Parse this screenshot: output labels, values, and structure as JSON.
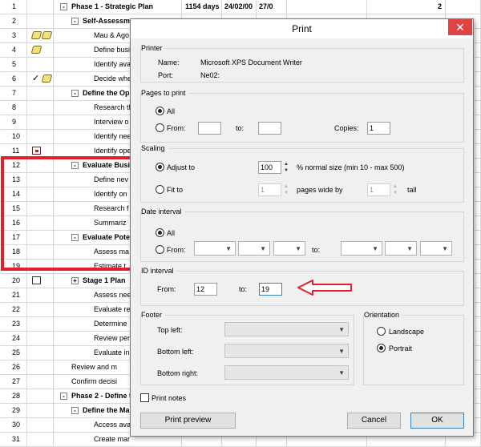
{
  "grid": {
    "rows": [
      {
        "id": "1",
        "indicators": [],
        "toggle": "-",
        "name": "Phase 1 - Strategic Plan",
        "bold": true,
        "indent": 0,
        "duration": "1154 days",
        "start": "24/02/00",
        "finish": "27/0",
        "x2": "2"
      },
      {
        "id": "2",
        "indicators": [],
        "toggle": "-",
        "name": "Self-Assessmen",
        "bold": true,
        "indent": 1
      },
      {
        "id": "3",
        "indicators": [
          "note-icon",
          "note-icon"
        ],
        "toggle": "",
        "name": "Mau & Ago",
        "bold": false,
        "indent": 2
      },
      {
        "id": "4",
        "indicators": [
          "note-icon"
        ],
        "toggle": "",
        "name": "Define busi",
        "bold": false,
        "indent": 2
      },
      {
        "id": "5",
        "indicators": [],
        "toggle": "",
        "name": "Identify ava",
        "bold": false,
        "indent": 2
      },
      {
        "id": "6",
        "indicators": [
          "check-icon",
          "note-icon"
        ],
        "toggle": "",
        "name": "Decide whe",
        "bold": false,
        "indent": 2
      },
      {
        "id": "7",
        "indicators": [],
        "toggle": "-",
        "name": "Define the Opp",
        "bold": true,
        "indent": 1
      },
      {
        "id": "8",
        "indicators": [],
        "toggle": "",
        "name": "Research th",
        "bold": false,
        "indent": 2
      },
      {
        "id": "9",
        "indicators": [],
        "toggle": "",
        "name": "Interview o",
        "bold": false,
        "indent": 2
      },
      {
        "id": "10",
        "indicators": [],
        "toggle": "",
        "name": "Identify nee",
        "bold": false,
        "indent": 2
      },
      {
        "id": "11",
        "indicators": [
          "calendar-icon"
        ],
        "toggle": "",
        "name": "Identify ope",
        "bold": false,
        "indent": 2
      },
      {
        "id": "12",
        "indicators": [],
        "toggle": "-",
        "name": "Evaluate Busin",
        "bold": true,
        "indent": 1
      },
      {
        "id": "13",
        "indicators": [],
        "toggle": "",
        "name": "Define nev",
        "bold": false,
        "indent": 2
      },
      {
        "id": "14",
        "indicators": [],
        "toggle": "",
        "name": "Identify on",
        "bold": false,
        "indent": 2
      },
      {
        "id": "15",
        "indicators": [],
        "toggle": "",
        "name": "Research f",
        "bold": false,
        "indent": 2
      },
      {
        "id": "16",
        "indicators": [],
        "toggle": "",
        "name": "Summariz",
        "bold": false,
        "indent": 2
      },
      {
        "id": "17",
        "indicators": [],
        "toggle": "-",
        "name": "Evaluate Poter",
        "bold": true,
        "indent": 1
      },
      {
        "id": "18",
        "indicators": [],
        "toggle": "",
        "name": "Assess ma",
        "bold": false,
        "indent": 2
      },
      {
        "id": "19",
        "indicators": [],
        "toggle": "",
        "name": "Estimate t",
        "bold": false,
        "indent": 2
      },
      {
        "id": "20",
        "indicators": [
          "document-icon"
        ],
        "toggle": "+",
        "name": "Stage 1 Plan",
        "bold": true,
        "indent": 1
      },
      {
        "id": "21",
        "indicators": [],
        "toggle": "",
        "name": "Assess nee",
        "bold": false,
        "indent": 2
      },
      {
        "id": "22",
        "indicators": [],
        "toggle": "",
        "name": "Evaluate re",
        "bold": false,
        "indent": 2
      },
      {
        "id": "23",
        "indicators": [],
        "toggle": "",
        "name": "Determine",
        "bold": false,
        "indent": 2
      },
      {
        "id": "24",
        "indicators": [],
        "toggle": "",
        "name": "Review per",
        "bold": false,
        "indent": 2
      },
      {
        "id": "25",
        "indicators": [],
        "toggle": "",
        "name": "Evaluate in",
        "bold": false,
        "indent": 2
      },
      {
        "id": "26",
        "indicators": [],
        "toggle": "",
        "name": "Review and m",
        "bold": false,
        "indent": 1
      },
      {
        "id": "27",
        "indicators": [],
        "toggle": "",
        "name": "Confirm decisi",
        "bold": false,
        "indent": 1
      },
      {
        "id": "28",
        "indicators": [],
        "toggle": "-",
        "name": "Phase 2 - Define th",
        "bold": true,
        "indent": 0
      },
      {
        "id": "29",
        "indicators": [],
        "toggle": "-",
        "name": "Define the Mar",
        "bold": true,
        "indent": 1
      },
      {
        "id": "30",
        "indicators": [],
        "toggle": "",
        "name": "Access ava",
        "bold": false,
        "indent": 2
      },
      {
        "id": "31",
        "indicators": [],
        "toggle": "",
        "name": "Create mar",
        "bold": false,
        "indent": 2
      }
    ]
  },
  "dialog": {
    "title": "Print",
    "close_glyph": "✕",
    "printer": {
      "group_label": "Printer",
      "name_label": "Name:",
      "name_value": "Microsoft XPS Document Writer",
      "port_label": "Port:",
      "port_value": "Ne02:"
    },
    "pages": {
      "group_label": "Pages to print",
      "all_label": "All",
      "from_label": "From:",
      "to_label": "to:",
      "copies_label": "Copies:",
      "copies_value": "1",
      "from_value": "",
      "to_value": ""
    },
    "scaling": {
      "group_label": "Scaling",
      "adjust_label": "Adjust to",
      "adjust_value": "100",
      "adjust_suffix": "% normal size (min 10 - max 500)",
      "fit_label": "Fit to",
      "fit_wide_value": "1",
      "fit_wide_suffix": "pages wide by",
      "fit_tall_value": "1",
      "fit_tall_suffix": "tall"
    },
    "date_interval": {
      "group_label": "Date interval",
      "all_label": "All",
      "from_label": "From:",
      "to_label": "to:"
    },
    "id_interval": {
      "group_label": "ID interval",
      "from_label": "From:",
      "from_value": "12",
      "to_label": "to:",
      "to_value": "19"
    },
    "footer": {
      "group_label": "Footer",
      "top_left_label": "Top left:",
      "bottom_left_label": "Bottom left:",
      "bottom_right_label": "Bottom right:"
    },
    "orientation": {
      "group_label": "Orientation",
      "landscape_label": "Landscape",
      "portrait_label": "Portrait",
      "selected": "Portrait"
    },
    "print_notes_label": "Print notes",
    "print_preview_label": "Print preview",
    "cancel_label": "Cancel",
    "ok_label": "OK"
  },
  "colors": {
    "highlight": "#e0202a",
    "close_button": "#e04343",
    "focus_border": "#3c7fb1"
  }
}
